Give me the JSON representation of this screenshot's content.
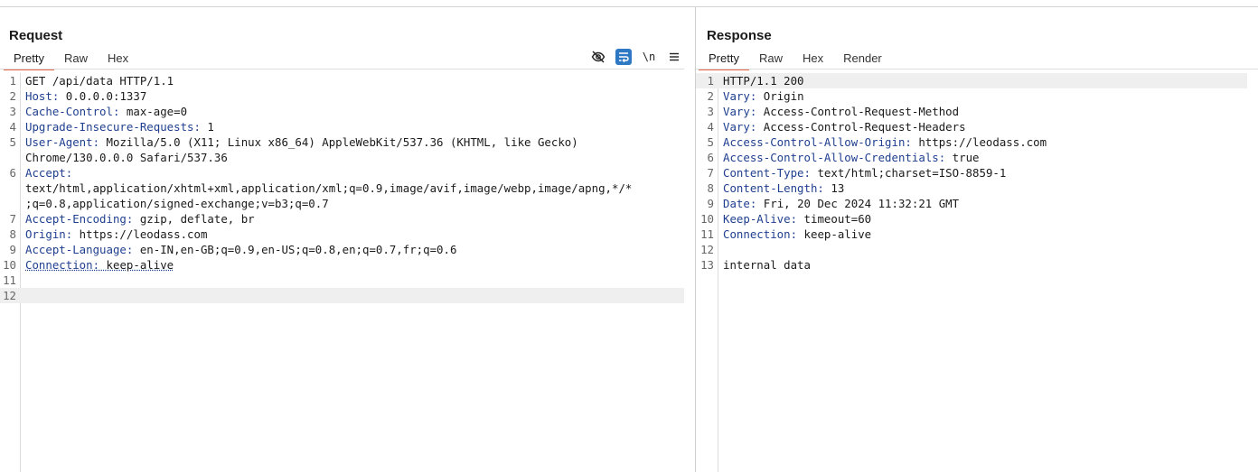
{
  "request": {
    "title": "Request",
    "tabs": [
      "Pretty",
      "Raw",
      "Hex"
    ],
    "active_tab": "Pretty",
    "tools": {
      "hide_icon": "eye-off-icon",
      "wrap_icon": "word-wrap-icon",
      "newline_label": "\\n",
      "menu_icon": "hamburger-menu-icon"
    },
    "lines": [
      {
        "n": "1",
        "key": "",
        "value": "GET /api/data HTTP/1.1"
      },
      {
        "n": "2",
        "key": "Host:",
        "value": " 0.0.0.0:1337"
      },
      {
        "n": "3",
        "key": "Cache-Control:",
        "value": " max-age=0"
      },
      {
        "n": "4",
        "key": "Upgrade-Insecure-Requests:",
        "value": " 1"
      },
      {
        "n": "5",
        "key": "User-Agent:",
        "value": " Mozilla/5.0 (X11; Linux x86_64) AppleWebKit/537.36 (KHTML, like Gecko)\nChrome/130.0.0.0 Safari/537.36"
      },
      {
        "n": "6",
        "key": "Accept:",
        "value": "\ntext/html,application/xhtml+xml,application/xml;q=0.9,image/avif,image/webp,image/apng,*/*\n;q=0.8,application/signed-exchange;v=b3;q=0.7"
      },
      {
        "n": "7",
        "key": "Accept-Encoding:",
        "value": " gzip, deflate, br"
      },
      {
        "n": "8",
        "key": "Origin:",
        "value": " https://leodass.com"
      },
      {
        "n": "9",
        "key": "Accept-Language:",
        "value": " en-IN,en-GB;q=0.9,en-US;q=0.8,en;q=0.7,fr;q=0.6"
      },
      {
        "n": "10",
        "key": "Connection:",
        "value": " keep-alive"
      },
      {
        "n": "11",
        "key": "",
        "value": ""
      },
      {
        "n": "12",
        "key": "",
        "value": ""
      }
    ]
  },
  "response": {
    "title": "Response",
    "tabs": [
      "Pretty",
      "Raw",
      "Hex",
      "Render"
    ],
    "active_tab": "Pretty",
    "lines": [
      {
        "n": "1",
        "key": "",
        "value": "HTTP/1.1 200"
      },
      {
        "n": "2",
        "key": "Vary:",
        "value": " Origin"
      },
      {
        "n": "3",
        "key": "Vary:",
        "value": " Access-Control-Request-Method"
      },
      {
        "n": "4",
        "key": "Vary:",
        "value": " Access-Control-Request-Headers"
      },
      {
        "n": "5",
        "key": "Access-Control-Allow-Origin:",
        "value": " https://leodass.com"
      },
      {
        "n": "6",
        "key": "Access-Control-Allow-Credentials:",
        "value": " true"
      },
      {
        "n": "7",
        "key": "Content-Type:",
        "value": " text/html;charset=ISO-8859-1"
      },
      {
        "n": "8",
        "key": "Content-Length:",
        "value": " 13"
      },
      {
        "n": "9",
        "key": "Date:",
        "value": " Fri, 20 Dec 2024 11:32:21 GMT"
      },
      {
        "n": "10",
        "key": "Keep-Alive:",
        "value": " timeout=60"
      },
      {
        "n": "11",
        "key": "Connection:",
        "value": " keep-alive"
      },
      {
        "n": "12",
        "key": "",
        "value": ""
      },
      {
        "n": "13",
        "key": "",
        "value": "internal data"
      }
    ]
  },
  "colors": {
    "accent_tab_underline": "#e8674a",
    "header_key": "#1f3f8f",
    "toggle_active": "#2f78c4"
  }
}
